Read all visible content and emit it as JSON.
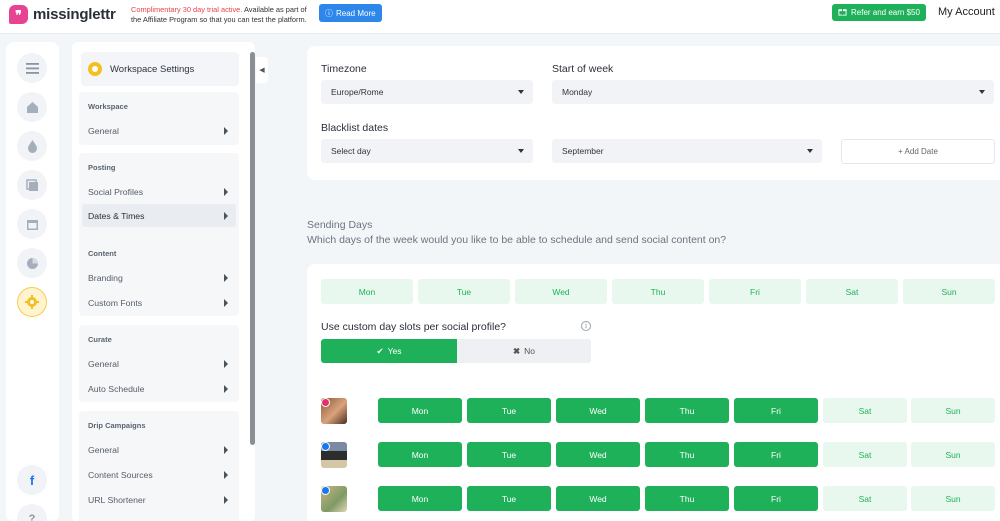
{
  "header": {
    "brand": "missinglettr",
    "trial_prefix": "Complimentary 30 day trial active.",
    "trial_rest": " Available as part of the Affiliate Program so that you can test the platform.",
    "read_more": "Read More",
    "refer": "Refer and earn $50",
    "account": "My Account"
  },
  "rail": [
    "menu-icon",
    "home-icon",
    "drop-icon",
    "copy-icon",
    "calendar-icon",
    "chart-icon",
    "gear-icon",
    "facebook-icon",
    "help-icon"
  ],
  "sidebar": {
    "title": "Workspace Settings",
    "groups": [
      {
        "title": "Workspace",
        "items": [
          "General"
        ]
      },
      {
        "title": "Posting",
        "items": [
          "Social Profiles",
          "Dates & Times"
        ]
      },
      {
        "title": "Content",
        "items": [
          "Branding",
          "Custom Fonts"
        ]
      },
      {
        "title": "Curate",
        "items": [
          "General",
          "Auto Schedule"
        ]
      },
      {
        "title": "Drip Campaigns",
        "items": [
          "General",
          "Content Sources",
          "URL Shortener"
        ]
      }
    ],
    "selected": "Dates & Times"
  },
  "settings": {
    "timezone_label": "Timezone",
    "timezone_value": "Europe/Rome",
    "week_label": "Start of week",
    "week_value": "Monday",
    "blacklist_label": "Blacklist dates",
    "day_select": "Select day",
    "month_select": "September",
    "add_date": "+ Add Date"
  },
  "sending": {
    "title": "Sending Days",
    "subtitle": "Which days of the week would you like to be able to schedule and send social content on?",
    "days": [
      "Mon",
      "Tue",
      "Wed",
      "Thu",
      "Fri",
      "Sat",
      "Sun"
    ],
    "custom_question": "Use custom day slots per social profile?",
    "info_glyph": "i",
    "yes": "Yes",
    "no": "No",
    "profiles": [
      {
        "network": "instagram",
        "badge_color": "#e1306c",
        "enabled": [
          true,
          true,
          true,
          true,
          true,
          false,
          false
        ]
      },
      {
        "network": "facebook",
        "badge_color": "#1877f2",
        "enabled": [
          true,
          true,
          true,
          true,
          true,
          false,
          false
        ]
      },
      {
        "network": "facebook",
        "badge_color": "#1877f2",
        "enabled": [
          true,
          true,
          true,
          true,
          true,
          false,
          false
        ]
      }
    ]
  },
  "colors": {
    "accent": "#1fb15a",
    "accent_light": "#e8f8ee",
    "brand": "#e84393",
    "link": "#2d86ea"
  }
}
